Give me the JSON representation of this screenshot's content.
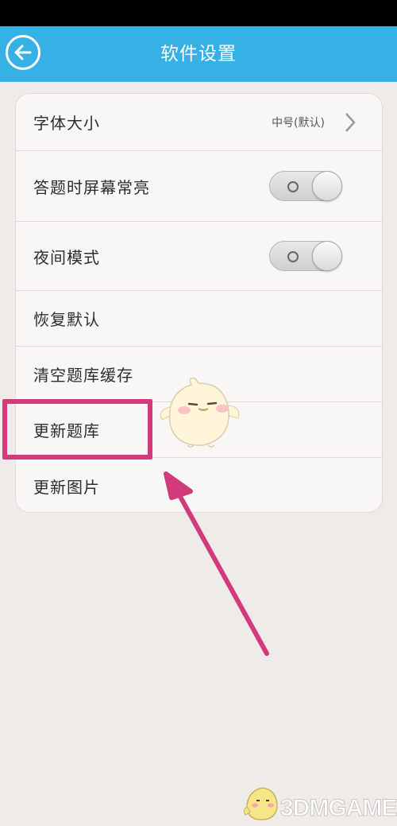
{
  "header": {
    "title": "软件设置"
  },
  "settings": {
    "font_size": {
      "label": "字体大小",
      "value": "中号(默认)"
    },
    "screen_on": {
      "label": "答题时屏幕常亮",
      "enabled": false
    },
    "night_mode": {
      "label": "夜间模式",
      "enabled": false
    },
    "restore_default": {
      "label": "恢复默认"
    },
    "clear_cache": {
      "label": "清空题库缓存"
    },
    "update_bank": {
      "label": "更新题库"
    },
    "update_images": {
      "label": "更新图片"
    }
  },
  "annotation": {
    "color": "#d33a7c"
  },
  "watermark": {
    "text": "3DMGAME"
  },
  "colors": {
    "header": "#35b1e5",
    "background": "#efebe8"
  }
}
